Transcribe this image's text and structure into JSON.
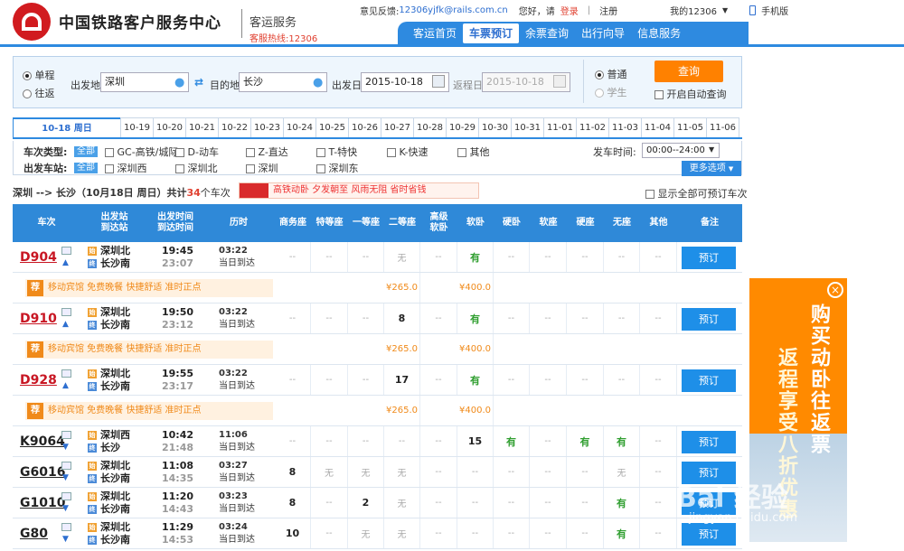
{
  "header": {
    "brand": "中国铁路客户服务中心",
    "subtitle": "客运服务",
    "hotline": "客服热线:12306",
    "feedback_label": "意见反馈:",
    "feedback_email": "12306yjfk@rails.com.cn",
    "greeting": "您好，请",
    "login": "登录",
    "sep": "|",
    "register": "注册",
    "my12306": "我的12306",
    "mobile": "手机版",
    "nav": [
      "客运首页",
      "车票预订",
      "余票查询",
      "出行向导",
      "信息服务"
    ]
  },
  "search": {
    "oneway": "单程",
    "roundtrip": "往返",
    "from_label": "出发地",
    "from_value": "深圳",
    "to_label": "目的地",
    "to_value": "长沙",
    "depart_label": "出发日",
    "depart_value": "2015-10-18",
    "return_label": "返程日",
    "return_value": "2015-10-18",
    "normal": "普通",
    "student": "学生",
    "query": "查询",
    "auto_query": "开启自动查询"
  },
  "dates": [
    "10-18 周日",
    "10-19",
    "10-20",
    "10-21",
    "10-22",
    "10-23",
    "10-24",
    "10-25",
    "10-26",
    "10-27",
    "10-28",
    "10-29",
    "10-30",
    "10-31",
    "11-01",
    "11-02",
    "11-03",
    "11-04",
    "11-05",
    "11-06"
  ],
  "filters": {
    "type_label": "车次类型:",
    "all": "全部",
    "types": [
      "GC-高铁/城际",
      "D-动车",
      "Z-直达",
      "T-特快",
      "K-快速",
      "其他"
    ],
    "station_label": "出发车站:",
    "stations": [
      "深圳西",
      "深圳北",
      "深圳",
      "深圳东"
    ],
    "time_label": "发车时间:",
    "time_value": "00:00--24:00",
    "more": "更多选项"
  },
  "summary": {
    "route": "深圳 --> 长沙（10月18日  周日）共计",
    "count": "34",
    "suffix": "个车次",
    "promo": "高铁动卧 夕发朝至 风雨无阻 省时省钱",
    "show_all": "显示全部可预订车次"
  },
  "table": {
    "headers": [
      "车次",
      "出发站\n到达站",
      "出发时间\n到达时间",
      "历时",
      "商务座",
      "特等座",
      "一等座",
      "二等座",
      "高级\n软卧",
      "软卧",
      "硬卧",
      "软座",
      "硬座",
      "无座",
      "其他",
      "备注"
    ],
    "book_label": "预订",
    "same_day": "当日到达",
    "promo_note": "移动宾馆 免费晚餐 快捷舒适 准时正点",
    "promo_badge": "荐",
    "rows": [
      {
        "no": "D904",
        "red": true,
        "from": "深圳北",
        "to": "长沙南",
        "dep": "19:45",
        "arr": "23:07",
        "dur": "03:22",
        "seats": [
          "--",
          "--",
          "--",
          "无",
          "--",
          "有",
          "--",
          "--",
          "--",
          "--",
          "--"
        ],
        "promo": true,
        "prices": [
          "¥265.0",
          "¥400.0"
        ]
      },
      {
        "no": "D910",
        "red": true,
        "from": "深圳北",
        "to": "长沙南",
        "dep": "19:50",
        "arr": "23:12",
        "dur": "03:22",
        "seats": [
          "--",
          "--",
          "--",
          "8",
          "--",
          "有",
          "--",
          "--",
          "--",
          "--",
          "--"
        ],
        "promo": true,
        "prices": [
          "¥265.0",
          "¥400.0"
        ]
      },
      {
        "no": "D928",
        "red": true,
        "from": "深圳北",
        "to": "长沙南",
        "dep": "19:55",
        "arr": "23:17",
        "dur": "03:22",
        "seats": [
          "--",
          "--",
          "--",
          "17",
          "--",
          "有",
          "--",
          "--",
          "--",
          "--",
          "--"
        ],
        "promo": true,
        "prices": [
          "¥265.0",
          "¥400.0"
        ]
      },
      {
        "no": "K9064",
        "red": false,
        "from": "深圳西",
        "to": "长沙",
        "dep": "10:42",
        "arr": "21:48",
        "dur": "11:06",
        "seats": [
          "--",
          "--",
          "--",
          "--",
          "--",
          "15",
          "有",
          "--",
          "有",
          "有",
          "--"
        ],
        "promo": false
      },
      {
        "no": "G6016",
        "red": false,
        "from": "深圳北",
        "to": "长沙南",
        "dep": "11:08",
        "arr": "14:35",
        "dur": "03:27",
        "seats": [
          "8",
          "无",
          "无",
          "无",
          "--",
          "--",
          "--",
          "--",
          "--",
          "无",
          "--"
        ],
        "promo": false
      },
      {
        "no": "G1010",
        "red": false,
        "from": "深圳北",
        "to": "长沙南",
        "dep": "11:20",
        "arr": "14:43",
        "dur": "03:23",
        "seats": [
          "8",
          "--",
          "2",
          "无",
          "--",
          "--",
          "--",
          "--",
          "--",
          "有",
          "--"
        ],
        "promo": false
      },
      {
        "no": "G80",
        "red": false,
        "from": "深圳北",
        "to": "长沙南",
        "dep": "11:29",
        "arr": "14:53",
        "dur": "03:24",
        "seats": [
          "10",
          "--",
          "无",
          "无",
          "--",
          "--",
          "--",
          "--",
          "--",
          "有",
          "--"
        ],
        "promo": false
      }
    ]
  },
  "ad": {
    "line1": "购买动卧往返票",
    "line2": "返程享受八折优惠",
    "close": "×",
    "watermark": "Bai 经验",
    "watermark_url": "jingyan.baidu.com"
  },
  "colors": {
    "accent": "#2e8ae0",
    "brand_red": "#d11b1f",
    "orange": "#ff8100",
    "green": "#2f9e2f"
  }
}
